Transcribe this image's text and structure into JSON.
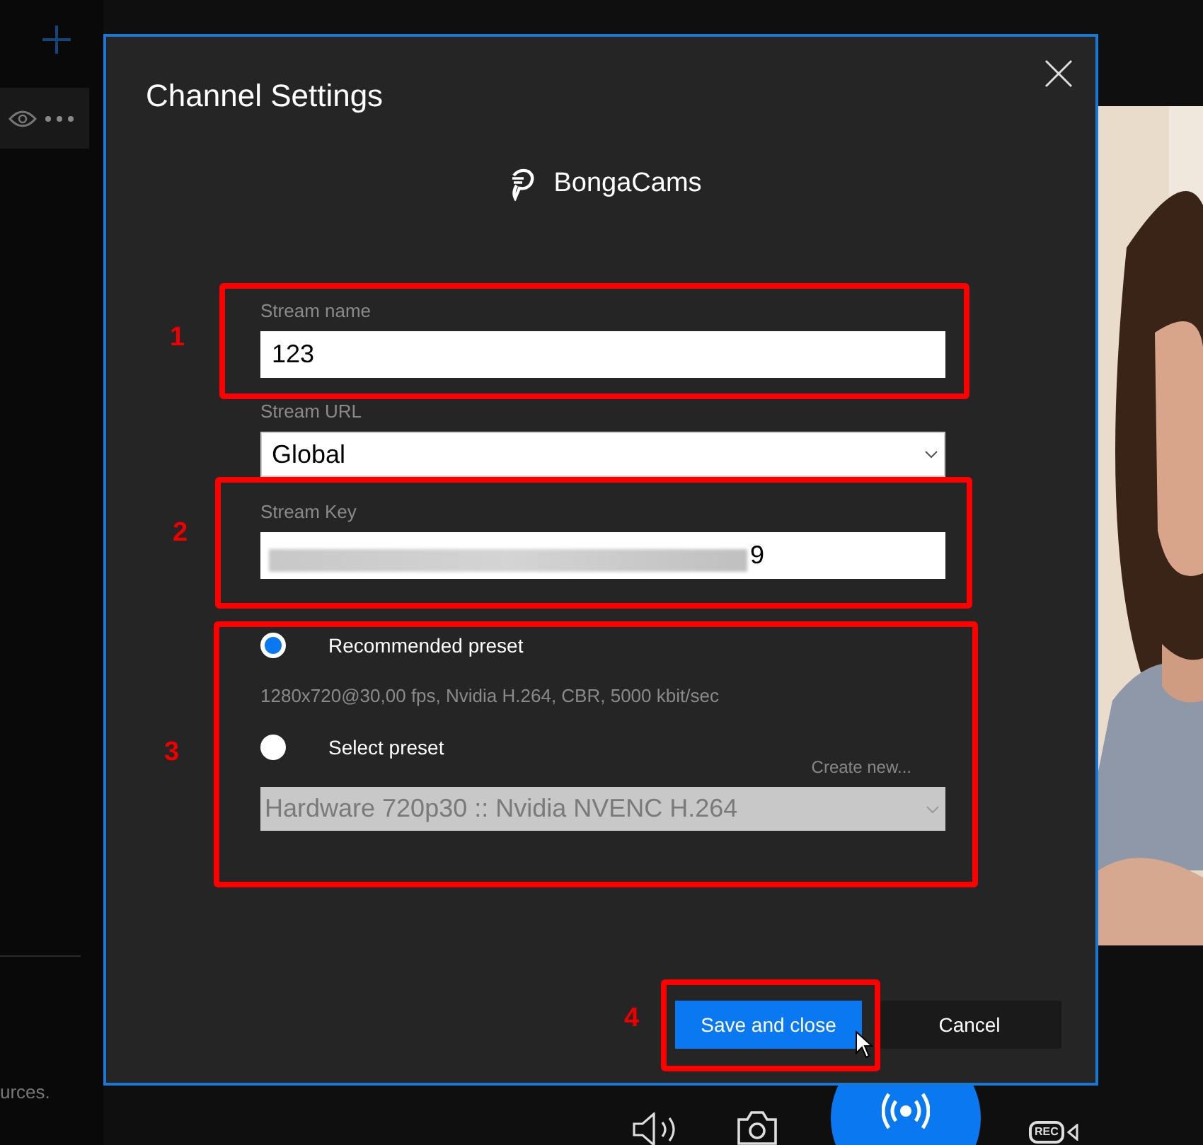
{
  "app": {
    "sidebar_text": "urces.",
    "rec_label": "REC"
  },
  "dialog": {
    "title": "Channel Settings",
    "service": "BongaCams",
    "fields": [
      {
        "kind": "text",
        "label": "Stream name",
        "value": "123"
      },
      {
        "kind": "select",
        "label": "Stream URL",
        "value": "Global"
      },
      {
        "kind": "secret",
        "label": "Stream Key",
        "value": "9"
      }
    ],
    "presets": [
      {
        "label": "Recommended preset",
        "selected": true,
        "detail": "1280x720@30,00 fps, Nvidia H.264, CBR, 5000 kbit/sec"
      },
      {
        "label": "Select preset",
        "selected": false
      }
    ],
    "create_link": "Create new...",
    "preset_select": {
      "value": "Hardware 720p30 :: Nvidia NVENC H.264",
      "disabled": true
    },
    "buttons": [
      {
        "label": "Save and close",
        "primary": true
      },
      {
        "label": "Cancel",
        "primary": false
      }
    ]
  },
  "annotations": [
    "1",
    "2",
    "3",
    "4"
  ]
}
